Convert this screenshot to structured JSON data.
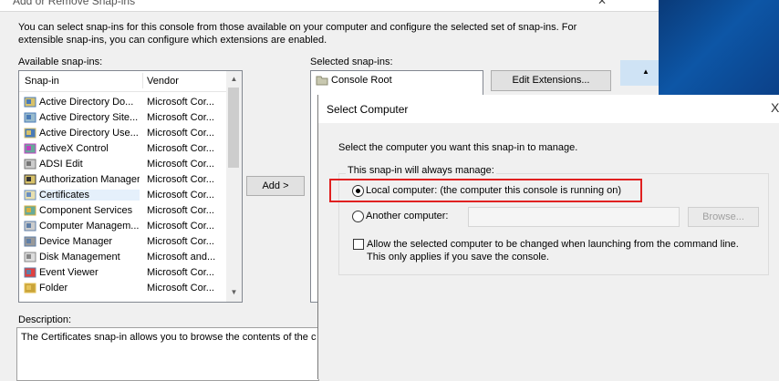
{
  "window": {
    "title": "Add or Remove Snap-ins"
  },
  "intro_text": "You can select snap-ins for this console from those available on your computer and configure the selected set of snap-ins. For extensible snap-ins, you can configure which extensions are enabled.",
  "available": {
    "label": "Available snap-ins:",
    "col_snapin": "Snap-in",
    "col_vendor": "Vendor",
    "items": [
      {
        "name": "Active Directory Do...",
        "vendor": "Microsoft Cor...",
        "icon": "ad-domains-icon"
      },
      {
        "name": "Active Directory Site...",
        "vendor": "Microsoft Cor...",
        "icon": "ad-sites-icon"
      },
      {
        "name": "Active Directory Use...",
        "vendor": "Microsoft Cor...",
        "icon": "ad-users-icon"
      },
      {
        "name": "ActiveX Control",
        "vendor": "Microsoft Cor...",
        "icon": "activex-icon"
      },
      {
        "name": "ADSI Edit",
        "vendor": "Microsoft Cor...",
        "icon": "adsi-icon"
      },
      {
        "name": "Authorization Manager",
        "vendor": "Microsoft Cor...",
        "icon": "authorization-icon"
      },
      {
        "name": "Certificates",
        "vendor": "Microsoft Cor...",
        "icon": "certificates-icon"
      },
      {
        "name": "Component Services",
        "vendor": "Microsoft Cor...",
        "icon": "component-services-icon"
      },
      {
        "name": "Computer Managem...",
        "vendor": "Microsoft Cor...",
        "icon": "computer-management-icon"
      },
      {
        "name": "Device Manager",
        "vendor": "Microsoft Cor...",
        "icon": "device-manager-icon"
      },
      {
        "name": "Disk Management",
        "vendor": "Microsoft and...",
        "icon": "disk-management-icon"
      },
      {
        "name": "Event Viewer",
        "vendor": "Microsoft Cor...",
        "icon": "event-viewer-icon"
      },
      {
        "name": "Folder",
        "vendor": "Microsoft Cor...",
        "icon": "folder-icon"
      }
    ]
  },
  "add_button": "Add >",
  "selected": {
    "label": "Selected snap-ins:",
    "items": [
      {
        "name": "Console Root",
        "icon": "folder-icon"
      }
    ]
  },
  "edit_extensions_button": "Edit Extensions...",
  "description": {
    "label": "Description:",
    "text": "The Certificates snap-in allows you to browse the contents of the c"
  },
  "select_computer": {
    "title": "Select Computer",
    "prompt": "Select the computer you want this snap-in to manage.",
    "group_label": "This snap-in will always manage:",
    "local_label": "Local computer:  (the computer this console is running on)",
    "local_selected": true,
    "another_label": "Another computer:",
    "another_value": "",
    "browse_button": "Browse...",
    "allow_change_label": "Allow the selected computer to be changed when launching from the command line.  This only applies if you save the console.",
    "allow_change_checked": false,
    "close_glyph": "X"
  },
  "colors": {
    "highlight": "#e02020",
    "selection": "#e5f0fb",
    "desktop": "#0d56a6"
  }
}
